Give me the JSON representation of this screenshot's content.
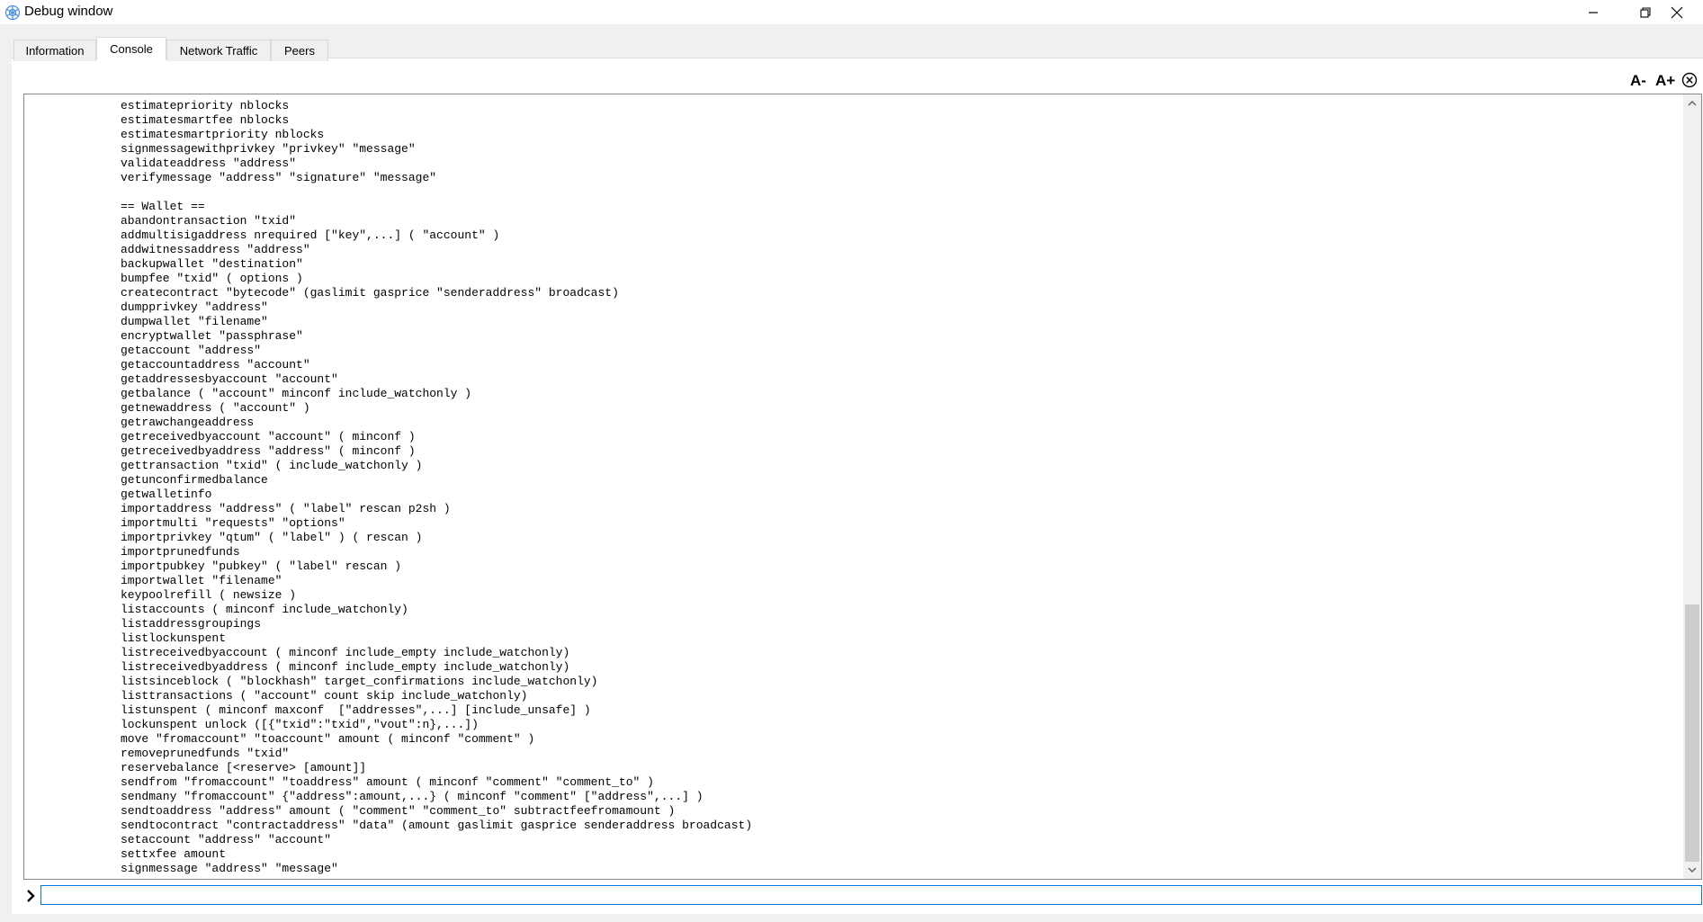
{
  "window": {
    "title": "Debug window",
    "minimize_icon": "minimize-icon",
    "restore_icon": "restore-icon",
    "close_icon": "close-icon"
  },
  "tabs": [
    {
      "label": "Information",
      "active": false
    },
    {
      "label": "Console",
      "active": true
    },
    {
      "label": "Network Traffic",
      "active": false
    },
    {
      "label": "Peers",
      "active": false
    }
  ],
  "console": {
    "font_smaller_label": "A-",
    "font_larger_label": "A+",
    "clear_icon": "clear-icon",
    "lines": [
      "estimatepriority nblocks",
      "estimatesmartfee nblocks",
      "estimatesmartpriority nblocks",
      "signmessagewithprivkey \"privkey\" \"message\"",
      "validateaddress \"address\"",
      "verifymessage \"address\" \"signature\" \"message\"",
      "",
      "== Wallet ==",
      "abandontransaction \"txid\"",
      "addmultisigaddress nrequired [\"key\",...] ( \"account\" )",
      "addwitnessaddress \"address\"",
      "backupwallet \"destination\"",
      "bumpfee \"txid\" ( options )",
      "createcontract \"bytecode\" (gaslimit gasprice \"senderaddress\" broadcast)",
      "dumpprivkey \"address\"",
      "dumpwallet \"filename\"",
      "encryptwallet \"passphrase\"",
      "getaccount \"address\"",
      "getaccountaddress \"account\"",
      "getaddressesbyaccount \"account\"",
      "getbalance ( \"account\" minconf include_watchonly )",
      "getnewaddress ( \"account\" )",
      "getrawchangeaddress",
      "getreceivedbyaccount \"account\" ( minconf )",
      "getreceivedbyaddress \"address\" ( minconf )",
      "gettransaction \"txid\" ( include_watchonly )",
      "getunconfirmedbalance",
      "getwalletinfo",
      "importaddress \"address\" ( \"label\" rescan p2sh )",
      "importmulti \"requests\" \"options\"",
      "importprivkey \"qtum\" ( \"label\" ) ( rescan )",
      "importprunedfunds",
      "importpubkey \"pubkey\" ( \"label\" rescan )",
      "importwallet \"filename\"",
      "keypoolrefill ( newsize )",
      "listaccounts ( minconf include_watchonly)",
      "listaddressgroupings",
      "listlockunspent",
      "listreceivedbyaccount ( minconf include_empty include_watchonly)",
      "listreceivedbyaddress ( minconf include_empty include_watchonly)",
      "listsinceblock ( \"blockhash\" target_confirmations include_watchonly)",
      "listtransactions ( \"account\" count skip include_watchonly)",
      "listunspent ( minconf maxconf  [\"addresses\",...] [include_unsafe] )",
      "lockunspent unlock ([{\"txid\":\"txid\",\"vout\":n},...])",
      "move \"fromaccount\" \"toaccount\" amount ( minconf \"comment\" )",
      "removeprunedfunds \"txid\"",
      "reservebalance [<reserve> [amount]]",
      "sendfrom \"fromaccount\" \"toaddress\" amount ( minconf \"comment\" \"comment_to\" )",
      "sendmany \"fromaccount\" {\"address\":amount,...} ( minconf \"comment\" [\"address\",...] )",
      "sendtoaddress \"address\" amount ( \"comment\" \"comment_to\" subtractfeefromamount )",
      "sendtocontract \"contractaddress\" \"data\" (amount gaslimit gasprice senderaddress broadcast)",
      "setaccount \"address\" \"account\"",
      "settxfee amount",
      "signmessage \"address\" \"message\""
    ]
  },
  "input": {
    "value": "",
    "prompt_icon": "chevron-right-icon"
  }
}
